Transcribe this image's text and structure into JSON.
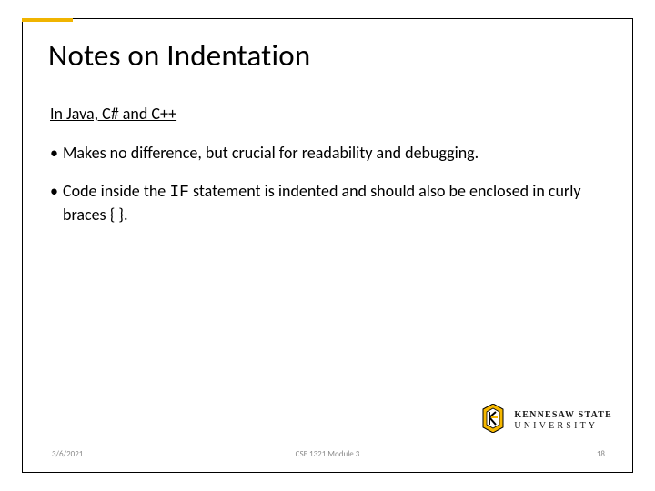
{
  "slide": {
    "title": "Notes on Indentation",
    "subhead": "In Java, C# and C++",
    "bullets": [
      {
        "pre": "Makes no difference, but crucial for readability and debugging."
      },
      {
        "pre": "Code inside the ",
        "code": "IF",
        "post": " statement is indented and should also be enclosed in curly braces { }."
      }
    ]
  },
  "footer": {
    "date": "3/6/2021",
    "mid": "CSE 1321 Module 3",
    "num": "18"
  },
  "logo": {
    "line1": "KENNESAW STATE",
    "line2": "UNIVERSITY"
  }
}
